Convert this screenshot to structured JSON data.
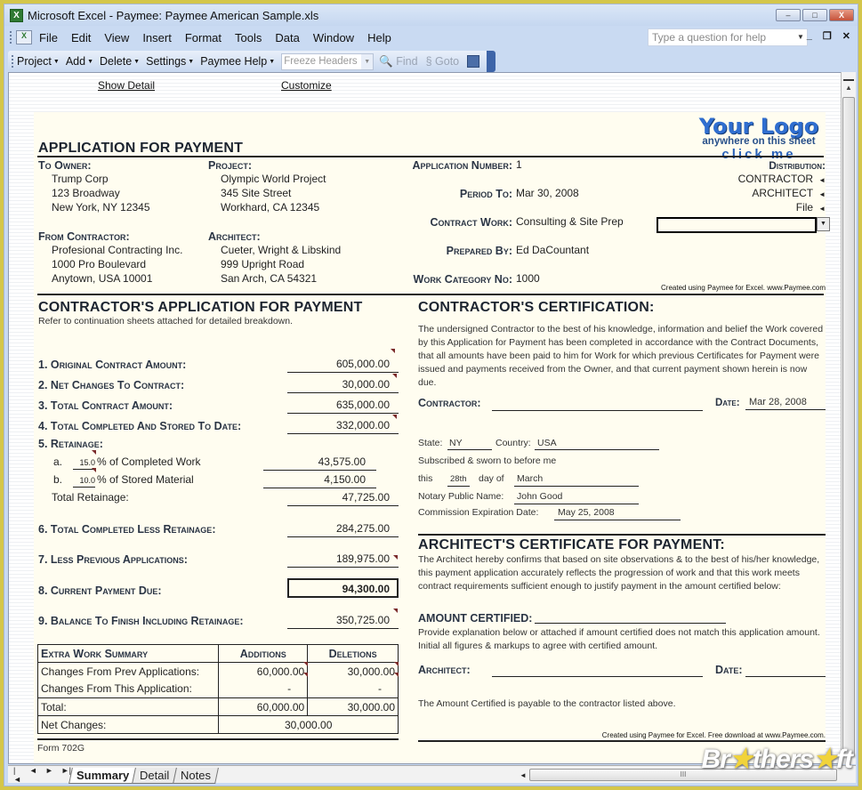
{
  "window": {
    "title": "Microsoft Excel - Paymee: Paymee American Sample.xls",
    "controls": {
      "minimize": "–",
      "maximize": "□",
      "close": "X"
    }
  },
  "menubar": {
    "items": [
      "File",
      "Edit",
      "View",
      "Insert",
      "Format",
      "Tools",
      "Data",
      "Window",
      "Help"
    ],
    "help_placeholder": "Type a question for help",
    "mdi": {
      "minimize": "_",
      "restore": "❐",
      "close": "✕"
    }
  },
  "toolbar": {
    "menus": [
      "Project",
      "Add",
      "Delete",
      "Settings",
      "Paymee Help"
    ],
    "freeze_select": "Freeze Headers",
    "find": "Find",
    "goto": "Goto"
  },
  "sheet_links": {
    "show_detail": "Show Detail",
    "customize": "Customize"
  },
  "logo": {
    "line1": "Your Logo",
    "line2": "anywhere on this sheet",
    "line3": "click me"
  },
  "header": {
    "title": "APPLICATION FOR PAYMENT",
    "to_owner": {
      "label": "To Owner:",
      "lines": [
        "Trump Corp",
        "123 Broadway",
        "New York, NY 12345"
      ]
    },
    "project": {
      "label": "Project:",
      "lines": [
        "Olympic World Project",
        "345 Site Street",
        "Workhard, CA 12345"
      ]
    },
    "from_contractor": {
      "label": "From Contractor:",
      "lines": [
        "Profesional Contracting Inc.",
        "1000 Pro Boulevard",
        "Anytown, USA 10001"
      ]
    },
    "architect": {
      "label": "Architect:",
      "lines": [
        "Cueter, Wright & Libskind",
        "999 Upright Road",
        "San Arch, CA 54321"
      ]
    },
    "application_number": {
      "label": "Application Number:",
      "value": "1"
    },
    "period_to": {
      "label": "Period To:",
      "value": "Mar 30, 2008"
    },
    "contract_work": {
      "label": "Contract Work:",
      "value": "Consulting & Site Prep"
    },
    "prepared_by": {
      "label": "Prepared By:",
      "value": "Ed DaCountant"
    },
    "work_category": {
      "label": "Work Category No:",
      "value": "1000"
    },
    "distribution": {
      "label": "Distribution:",
      "items": [
        "CONTRACTOR",
        "ARCHITECT",
        "File"
      ],
      "marker": "◄"
    },
    "credit": "Created using Paymee for Excel.  www.Paymee.com"
  },
  "application": {
    "title": "CONTRACTOR'S APPLICATION FOR PAYMENT",
    "subtitle": "Refer to continuation sheets attached for detailed breakdown.",
    "lines": [
      {
        "label": "1. Original Contract Amount:",
        "value": "605,000.00"
      },
      {
        "label": "2. Net Changes To Contract:",
        "value": "30,000.00"
      },
      {
        "label": "3. Total Contract Amount:",
        "value": "635,000.00"
      },
      {
        "label": "4. Total Completed And Stored To Date:",
        "value": "332,000.00"
      }
    ],
    "retainage": {
      "label": "5. Retainage:",
      "a": {
        "letter": "a.",
        "pct": "15.0",
        "text": "% of Completed Work",
        "value": "43,575.00"
      },
      "b": {
        "letter": "b.",
        "pct": "10.0",
        "text": "% of Stored Material",
        "value": "4,150.00"
      },
      "total": {
        "label": "Total Retainage:",
        "value": "47,725.00"
      }
    },
    "line6": {
      "label": "6. Total Completed Less Retainage:",
      "value": "284,275.00"
    },
    "line7": {
      "label": "7. Less Previous Applications:",
      "value": "189,975.00"
    },
    "line8": {
      "label": "8. Current Payment Due:",
      "value": "94,300.00"
    },
    "line9": {
      "label": "9. Balance To Finish Including Retainage:",
      "value": "350,725.00"
    }
  },
  "extra_work": {
    "headers": [
      "Extra Work Summary",
      "Additions",
      "Deletions"
    ],
    "rows": [
      {
        "label": "Changes From Prev Applications:",
        "additions": "60,000.00",
        "deletions": "30,000.00"
      },
      {
        "label": "Changes From This Application:",
        "additions": "-",
        "deletions": "-"
      },
      {
        "label": "Total:",
        "additions": "60,000.00",
        "deletions": "30,000.00"
      }
    ],
    "net": {
      "label": "Net Changes:",
      "value": "30,000.00"
    }
  },
  "form_id": "Form 702G",
  "certification": {
    "title": "CONTRACTOR'S CERTIFICATION:",
    "text": "The undersigned Contractor to the best of his knowledge, information and belief the Work covered by this Application for Payment has been completed in accordance with the Contract Documents, that all amounts have been paid to him for Work for which previous Certificates for Payment were issued and payments received from the Owner, and that current payment shown herein is now due.",
    "contractor_label": "Contractor:",
    "date_label": "Date:",
    "date_value": "Mar 28, 2008",
    "state_label": "State:",
    "state": "NY",
    "country_label": "Country:",
    "country": "USA",
    "sworn": "Subscribed & sworn to before me",
    "this_label": "this",
    "day": "28th",
    "day_of_label": "day of",
    "month": "March",
    "notary_label": "Notary Public Name:",
    "notary": "John Good",
    "expiration_label": "Commission Expiration Date:",
    "expiration": "May 25, 2008"
  },
  "architect_cert": {
    "title": "ARCHITECT'S CERTIFICATE FOR PAYMENT:",
    "text": "The Architect hereby confirms that based on site observations & to the best of his/her knowledge, this payment application accurately reflects the progression of work and that this work meets contract requirements sufficient enough to justify payment in the amount certified below:",
    "amount_label": "AMOUNT CERTIFIED:",
    "explain": "Provide explanation below or attached if amount certified does not match this application amount.  Initial all figures & markups to agree with certified amount.",
    "architect_label": "Architect:",
    "date_label": "Date:",
    "payable": "The Amount Certified is payable to the contractor listed above.",
    "credit": "Created using Paymee for Excel.  Free download at www.Paymee.com."
  },
  "sheet_tabs": [
    {
      "label": "Summary",
      "active": true
    },
    {
      "label": "Detail",
      "active": false
    },
    {
      "label": "Notes",
      "active": false
    }
  ],
  "tab_nav": [
    "|◄",
    "◄",
    "►",
    "►|"
  ],
  "watermark": {
    "pre": "Br",
    "star": "★",
    "mid": "thers",
    "post": "ft"
  }
}
